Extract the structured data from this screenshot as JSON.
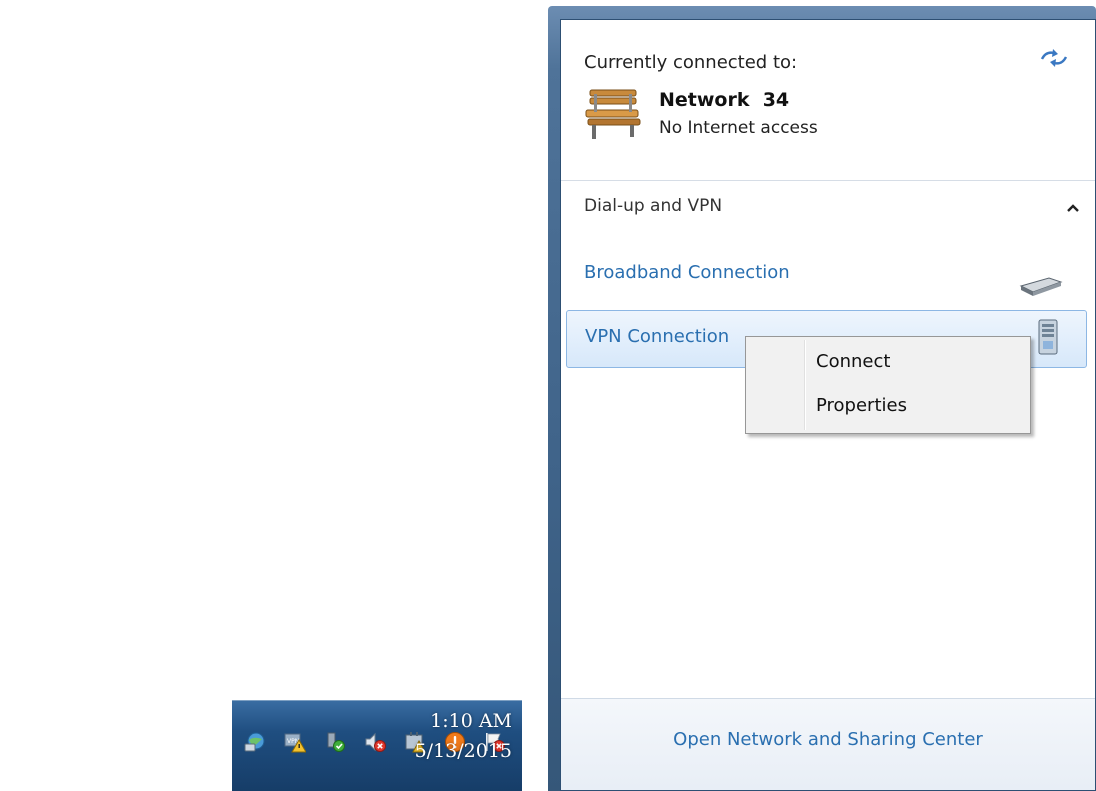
{
  "taskbar": {
    "tray_icons": [
      "network-globe-icon",
      "vpn-warning-icon",
      "usb-device-icon",
      "speaker-muted-icon",
      "power-warning-icon",
      "alert-icon",
      "action-center-flag-icon"
    ],
    "clock": {
      "time": "1:10 AM",
      "date": "5/13/2015"
    }
  },
  "flyout": {
    "connected_header": "Currently connected to:",
    "current_network": {
      "name": "Network  34",
      "status": "No Internet access",
      "icon": "bench-icon"
    },
    "group_header": "Dial-up and VPN",
    "connections": [
      {
        "label": "Broadband Connection",
        "icon": "modem-icon",
        "selected": false
      },
      {
        "label": "VPN Connection",
        "icon": "vpn-server-icon",
        "selected": true
      }
    ],
    "footer_link": "Open Network and Sharing Center"
  },
  "context_menu": {
    "items": [
      "Connect",
      "Properties"
    ]
  },
  "colors": {
    "link": "#2a6fb0",
    "taskbar": "#1f4e80",
    "selection": "#d7e8fa"
  }
}
